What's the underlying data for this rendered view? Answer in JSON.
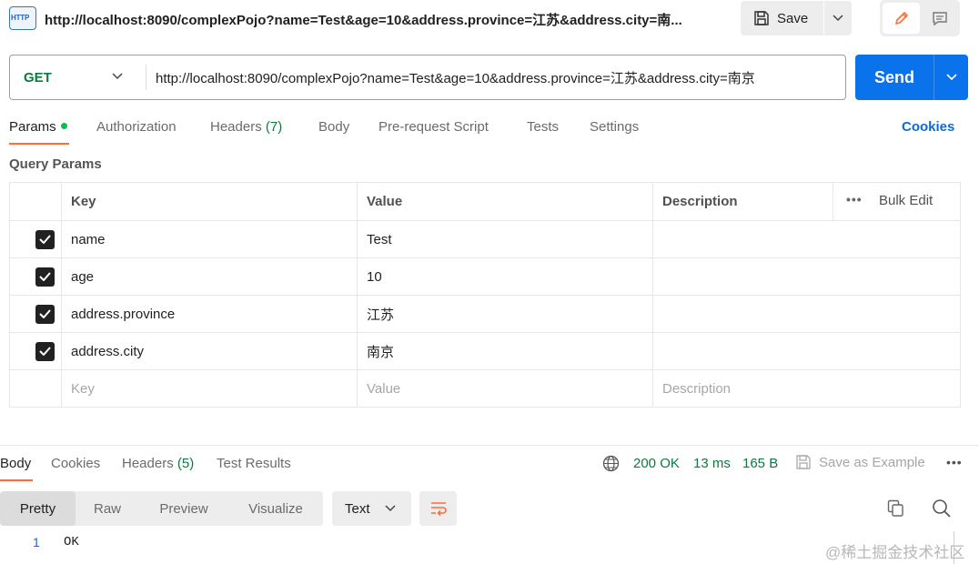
{
  "header": {
    "http_icon_label": "HTTP",
    "request_title": "http://localhost:8090/complexPojo?name=Test&age=10&address.province=江苏&address.city=南...",
    "save_label": "Save"
  },
  "request": {
    "method": "GET",
    "url": "http://localhost:8090/complexPojo?name=Test&age=10&address.province=江苏&address.city=南京",
    "send_label": "Send"
  },
  "request_tabs": {
    "params": "Params",
    "authorization": "Authorization",
    "headers": "Headers",
    "headers_count": "(7)",
    "body": "Body",
    "prerequest": "Pre-request Script",
    "tests": "Tests",
    "settings": "Settings",
    "cookies": "Cookies"
  },
  "query_params": {
    "section_label": "Query Params",
    "columns": {
      "key": "Key",
      "value": "Value",
      "description": "Description",
      "bulk_edit": "Bulk Edit",
      "more": "•••"
    },
    "rows": [
      {
        "key": "name",
        "value": "Test",
        "description": "",
        "checked": true
      },
      {
        "key": "age",
        "value": "10",
        "description": "",
        "checked": true
      },
      {
        "key": "address.province",
        "value": "江苏",
        "description": "",
        "checked": true
      },
      {
        "key": "address.city",
        "value": "南京",
        "description": "",
        "checked": true
      }
    ],
    "placeholders": {
      "key": "Key",
      "value": "Value",
      "description": "Description"
    }
  },
  "response": {
    "tabs": {
      "body": "Body",
      "cookies": "Cookies",
      "headers": "Headers",
      "headers_count": "(5)",
      "test_results": "Test Results"
    },
    "status": "200 OK",
    "time": "13 ms",
    "size": "165 B",
    "save_as_example": "Save as Example",
    "more": "•••",
    "views": {
      "pretty": "Pretty",
      "raw": "Raw",
      "preview": "Preview",
      "visualize": "Visualize"
    },
    "format": "Text",
    "lines": [
      {
        "no": "1",
        "text": "OK"
      }
    ]
  },
  "watermark": "@稀土掘金技术社区",
  "colors": {
    "accent_orange": "#ff6c37",
    "send_blue": "#0a73eb",
    "success_green": "#0b7a3e",
    "link_blue": "#0a6bd9"
  }
}
